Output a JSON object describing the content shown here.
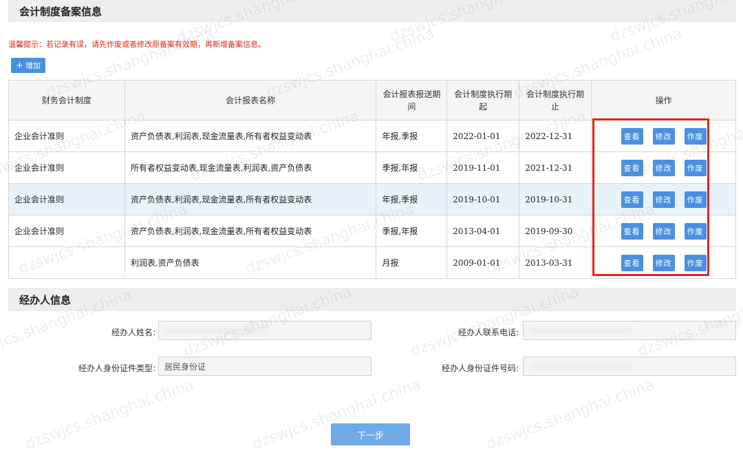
{
  "accounting_section": {
    "title": "会计制度备案信息",
    "tip": "温馨提示：若记录有误，请先作废或者修改原备案有效期，再新增备案信息。",
    "add_button": "增加",
    "columns": [
      "财务会计制度",
      "会计报表名称",
      "会计报表报送期间",
      "会计制度执行期起",
      "会计制度执行期止",
      "操作"
    ],
    "rows": [
      {
        "system": "企业会计准则",
        "reports": "资产负债表,利润表,现金流量表,所有者权益变动表",
        "period": "年报,季报",
        "start": "2022-01-01",
        "end": "2022-12-31"
      },
      {
        "system": "企业会计准则",
        "reports": "所有者权益变动表,现金流量表,利润表,资产负债表",
        "period": "季报,年报",
        "start": "2019-11-01",
        "end": "2021-12-31"
      },
      {
        "system": "企业会计准则",
        "reports": "资产负债表,利润表,现金流量表,所有者权益变动表",
        "period": "年报,季报",
        "start": "2019-10-01",
        "end": "2019-10-31"
      },
      {
        "system": "企业会计准则",
        "reports": "资产负债表,利润表,现金流量表,所有者权益变动表",
        "period": "季报,年报",
        "start": "2013-04-01",
        "end": "2019-09-30"
      },
      {
        "system": "",
        "reports": "利润表,资产负债表",
        "period": "月报",
        "start": "2009-01-01",
        "end": "2013-03-31"
      }
    ],
    "ops": {
      "view": "查看",
      "edit": "修改",
      "void": "作废"
    }
  },
  "handler_section": {
    "title": "经办人信息",
    "name_label": "经办人姓名:",
    "phone_label": "经办人联系电话:",
    "id_type_label": "经办人身份证件类型:",
    "id_type_value": "居民身份证",
    "id_number_label": "经办人身份证件号码:"
  },
  "next_button": "下一步",
  "watermark": "dzswjcs.shanghai.china",
  "colors": {
    "primary": "#4a90e2",
    "danger": "#e0261c",
    "highlight_row": "#e8f2fb"
  }
}
